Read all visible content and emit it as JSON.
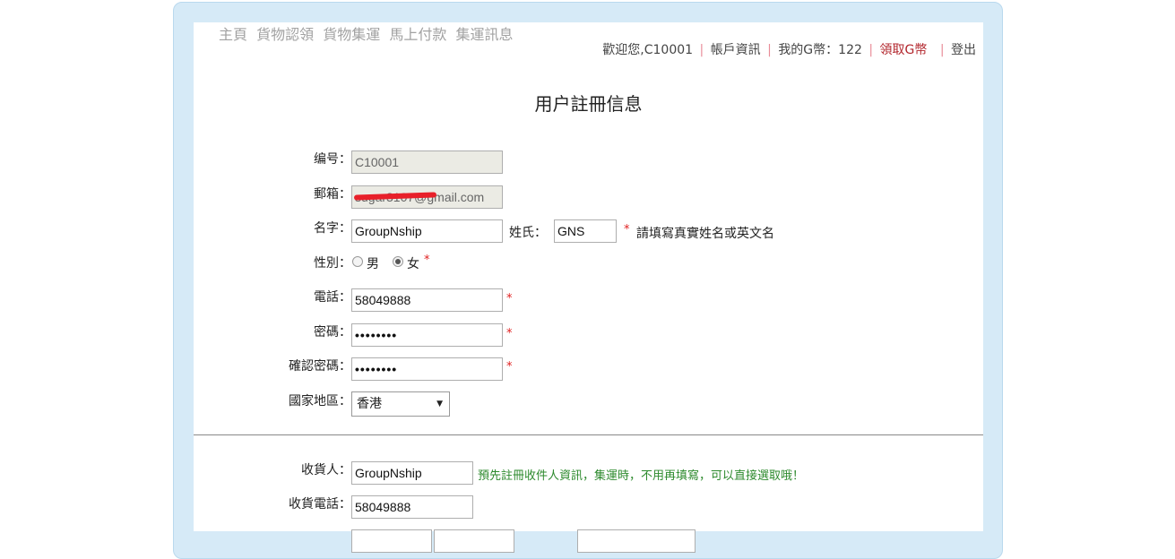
{
  "nav": {
    "items": [
      "主頁",
      "貨物認領",
      "貨物集運",
      "馬上付款",
      "集運訊息"
    ]
  },
  "userbar": {
    "welcome": "歡迎您,C10001",
    "account_info": "帳戶資訊",
    "my_coins": "我的G幣：122",
    "claim_coins": "領取G幣",
    "logout": "登出"
  },
  "page_title": "用户註冊信息",
  "form": {
    "id_label": "编号：",
    "id_value": "C10001",
    "email_label": "郵箱：",
    "email_value": "sugar3107@gmail.com",
    "name_label": "名字：",
    "name_value": "GroupNship",
    "surname_label": "姓氏：",
    "surname_value": "GNS",
    "name_hint": "請填寫真實姓名或英文名",
    "gender_label": "性別：",
    "gender_male": "男",
    "gender_female": "女",
    "gender_selected": "女",
    "phone_label": "電話：",
    "phone_value": "58049888",
    "password_label": "密碼：",
    "password_value": "••••••••",
    "confirm_label": "確認密碼：",
    "confirm_value": "••••••••",
    "region_label": "國家地區：",
    "region_value": "香港",
    "required_mark": "*"
  },
  "recipient": {
    "name_label": "收貨人：",
    "name_value": "GroupNship",
    "hint": "預先註冊收件人資訊，集運時，不用再填寫，可以直接選取哦！",
    "phone_label": "收貨電話：",
    "phone_value": "58049888"
  }
}
